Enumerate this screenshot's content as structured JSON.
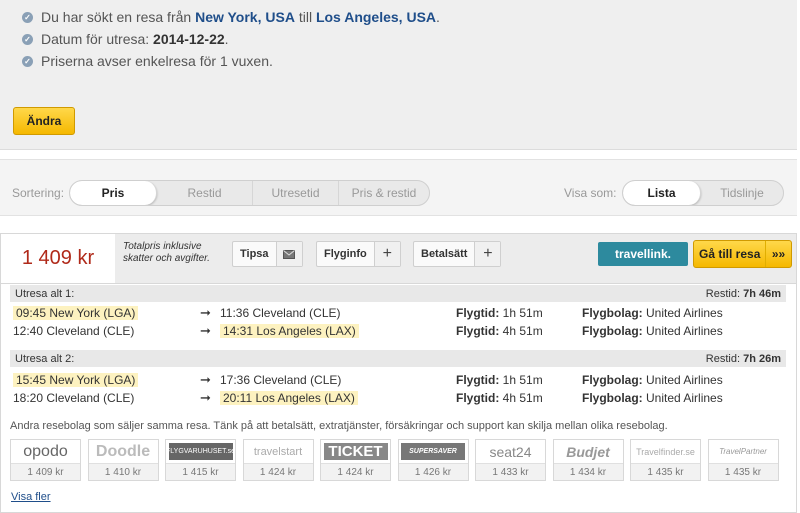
{
  "summary": {
    "line1_pre": "Du har sökt en resa från",
    "from_city": "New York, USA",
    "line1_mid": "till",
    "to_city": "Los Angeles, USA",
    "line1_end": ".",
    "line2_pre": "Datum för utresa:",
    "date": "2014-12-22",
    "line2_end": ".",
    "line3": "Priserna avser enkelresa för 1 vuxen.",
    "change_button": "Ändra"
  },
  "sort": {
    "label": "Sortering:",
    "options": [
      "Pris",
      "Restid",
      "Utresetid",
      "Pris & restid"
    ],
    "active": "Pris",
    "view_label": "Visa som:",
    "view_options": [
      "Lista",
      "Tidslinje"
    ],
    "view_active": "Lista"
  },
  "result": {
    "price": "1 409 kr",
    "price_note": "Totalpris inklusive skatter och avgifter.",
    "buttons": {
      "tipsa": "Tipsa",
      "flyginfo": "Flyginfo",
      "betalsatt": "Betalsätt"
    },
    "agent_logo": "travellink.",
    "goto_button": "Gå till resa",
    "goto_arrows": "»»",
    "options": [
      {
        "title": "Utresa alt 1:",
        "restid_label": "Restid:",
        "restid": "7h 46m",
        "segments": [
          {
            "dep": "09:45 New York (LGA)",
            "arr": "11:36 Cleveland (CLE)",
            "flytid_label": "Flygtid:",
            "flytid": "1h 51m",
            "airline_label": "Flygbolag:",
            "airline": "United Airlines"
          },
          {
            "dep": "12:40 Cleveland (CLE)",
            "arr": "14:31 Los Angeles (LAX)",
            "flytid_label": "Flygtid:",
            "flytid": "4h 51m",
            "airline_label": "Flygbolag:",
            "airline": "United Airlines"
          }
        ]
      },
      {
        "title": "Utresa alt 2:",
        "restid_label": "Restid:",
        "restid": "7h 26m",
        "segments": [
          {
            "dep": "15:45 New York (LGA)",
            "arr": "17:36 Cleveland (CLE)",
            "flytid_label": "Flygtid:",
            "flytid": "1h 51m",
            "airline_label": "Flygbolag:",
            "airline": "United Airlines"
          },
          {
            "dep": "18:20 Cleveland (CLE)",
            "arr": "20:11 Los Angeles (LAX)",
            "flytid_label": "Flygtid:",
            "flytid": "4h 51m",
            "airline_label": "Flygbolag:",
            "airline": "United Airlines"
          }
        ]
      }
    ],
    "agents_note": "Andra resebolag som säljer samma resa. Tänk på att betalsätt, extratjänster, försäkringar och support kan skilja mellan olika resebolag.",
    "agents": [
      {
        "name": "opodo",
        "price": "1 409 kr"
      },
      {
        "name": "Doodle",
        "price": "1 410 kr"
      },
      {
        "name": "FLYGVARUHUSET.se",
        "price": "1 415 kr"
      },
      {
        "name": "travelstart",
        "price": "1 424 kr"
      },
      {
        "name": "TICKET",
        "price": "1 424 kr"
      },
      {
        "name": "SUPERSAVER",
        "price": "1 426 kr"
      },
      {
        "name": "seat24",
        "price": "1 433 kr"
      },
      {
        "name": "Budjet",
        "price": "1 434 kr"
      },
      {
        "name": "Travelfinder.se",
        "price": "1 435 kr"
      },
      {
        "name": "TravelPartner",
        "price": "1 435 kr"
      }
    ],
    "show_more": "Visa fler"
  }
}
